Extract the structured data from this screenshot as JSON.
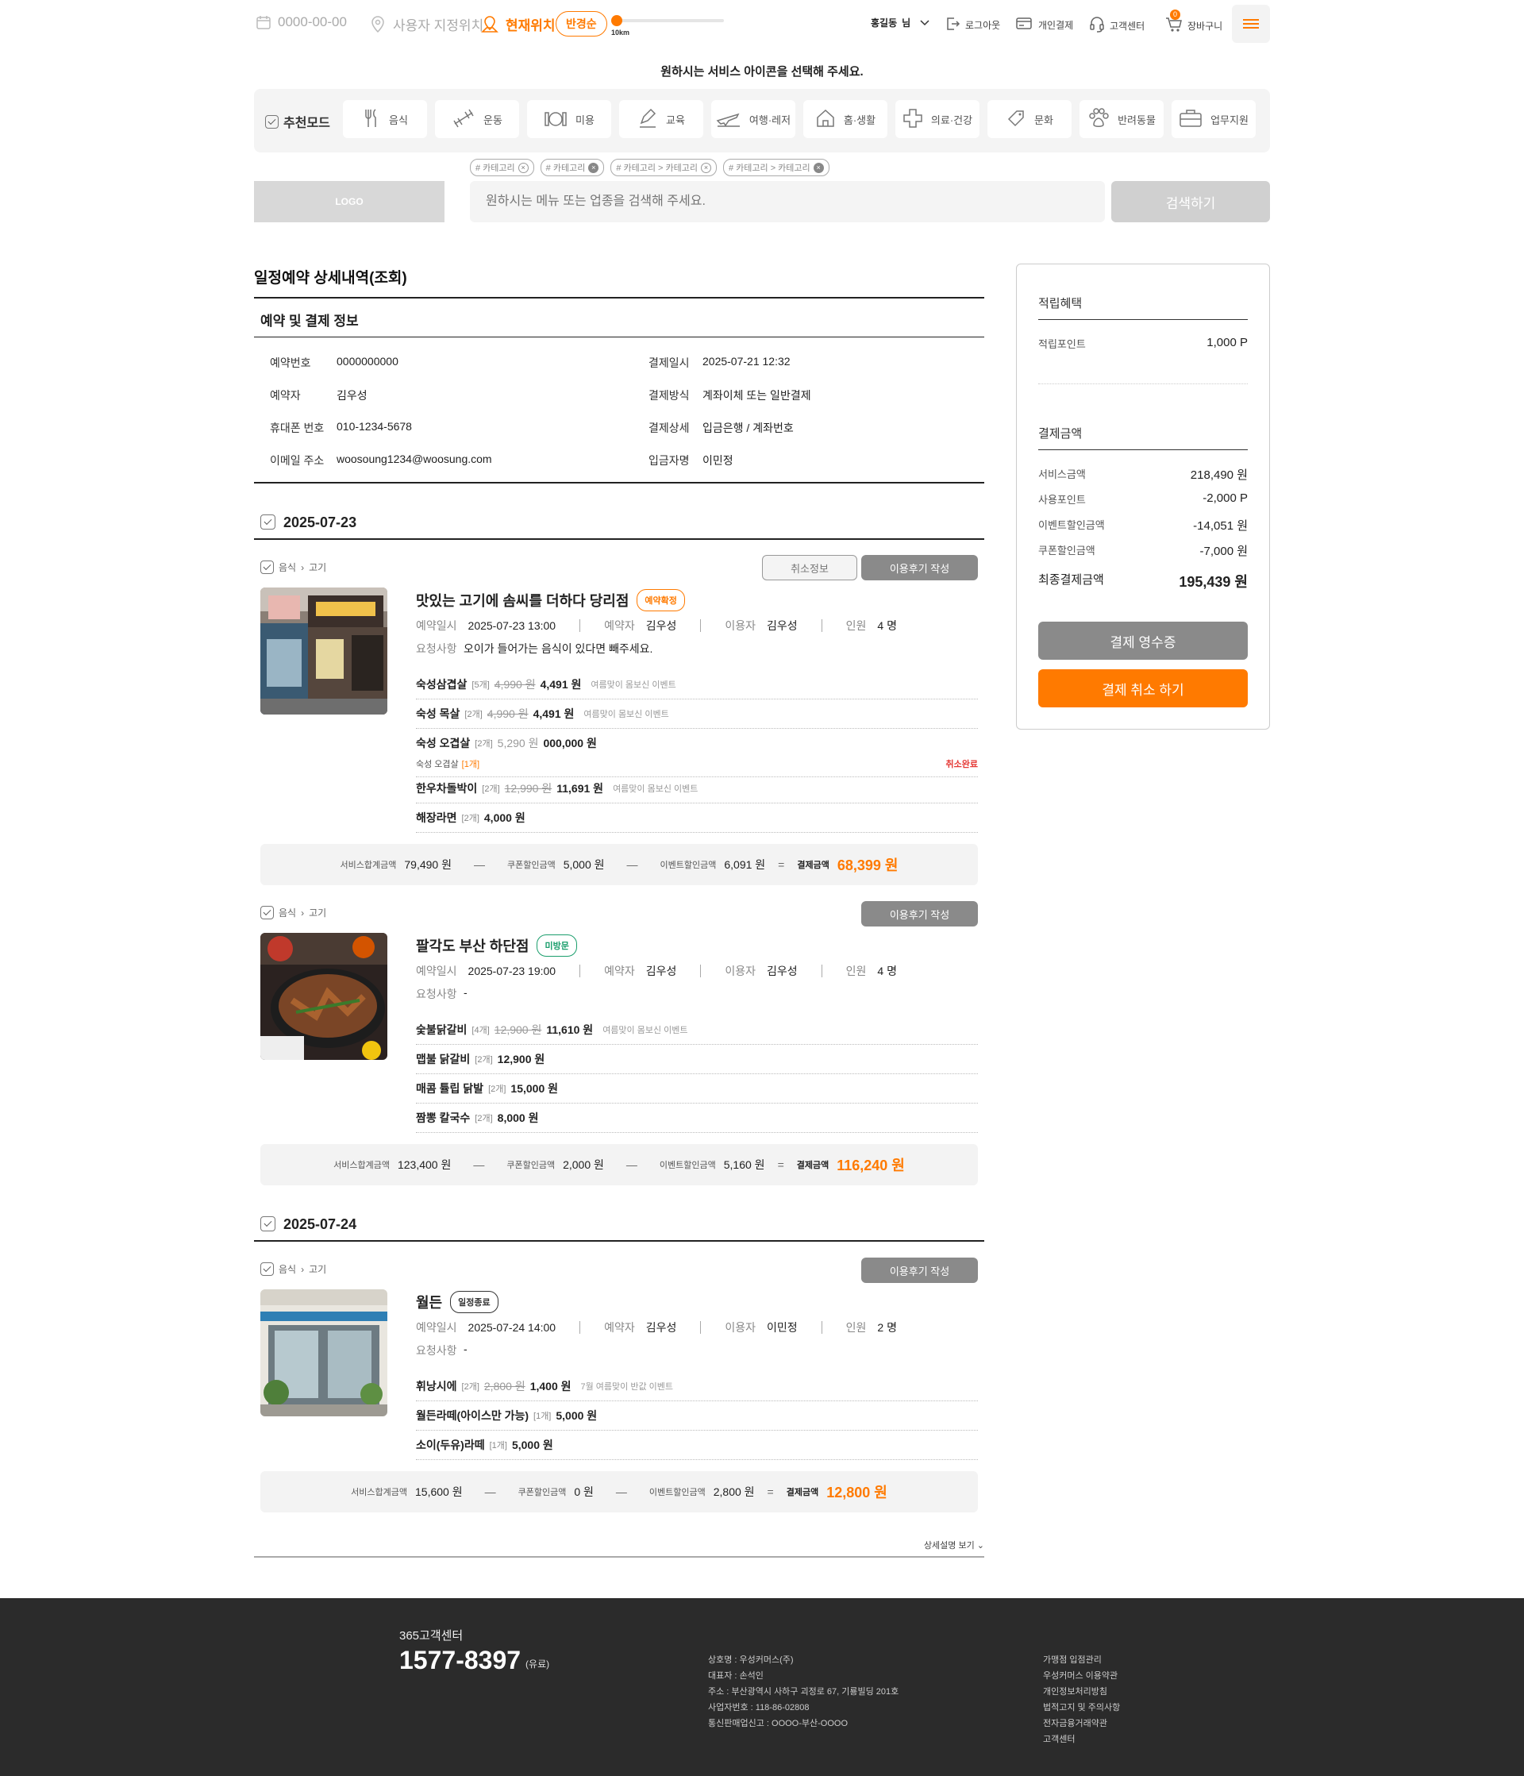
{
  "topbar": {
    "date": "0000-00-00",
    "user_location": "사용자 지정위치",
    "current_location": "현재위치",
    "radius_sort": "반경순",
    "distance": "10km",
    "user_name": "홍길동",
    "user_suffix": "님",
    "logout": "로그아웃",
    "personal_pay": "개인결제",
    "customer_center": "고객센터",
    "cart": "장바구니",
    "cart_count": "0"
  },
  "guide_text": "원하시는 서비스 아이콘을 선택해 주세요.",
  "categories": {
    "recommend": "추천모드",
    "items": [
      "음식",
      "운동",
      "미용",
      "교육",
      "여행·레저",
      "홈·생활",
      "의료·건강",
      "문화",
      "반려동물",
      "업무지원"
    ]
  },
  "tags": [
    "# 카테고리",
    "# 카테고리",
    "# 카테고리 > 카테고리",
    "# 카테고리 > 카테고리"
  ],
  "search": {
    "logo": "LOGO",
    "placeholder": "원하시는 메뉴 또는 업종을 검색해 주세요.",
    "button": "검색하기"
  },
  "page_title": "일정예약 상세내역(조회)",
  "section_title": "예약 및 결제 정보",
  "info": {
    "left": [
      {
        "k": "예약번호",
        "v": "0000000000"
      },
      {
        "k": "예약자",
        "v": "김우성"
      },
      {
        "k": "휴대폰 번호",
        "v": "010-1234-5678"
      },
      {
        "k": "이메일 주소",
        "v": "woosoung1234@woosung.com"
      }
    ],
    "right": [
      {
        "k": "결제일시",
        "v": "2025-07-21  12:32"
      },
      {
        "k": "결제방식",
        "v": "계좌이체 또는 일반결제"
      },
      {
        "k": "결제상세",
        "v": "입금은행 / 계좌번호"
      },
      {
        "k": "입금자명",
        "v": "이민정"
      }
    ]
  },
  "labels": {
    "reserve_time": "예약일시",
    "reserver": "예약자",
    "user": "이용자",
    "people": "인원",
    "request": "요청사항",
    "service_total": "서비스합계금액",
    "coupon_discount": "쿠폰할인금액",
    "event_discount": "이벤트할인금액",
    "paid": "결제금액",
    "cancel_info": "취소정보",
    "write_review": "이용후기 작성",
    "canceled": "취소완료",
    "more": "상세설명 보기"
  },
  "dates": [
    "2025-07-23",
    "2025-07-24"
  ],
  "orders": [
    {
      "crumb_a": "음식",
      "crumb_b": "고기",
      "name": "맛있는 고기에 솜씨를 더하다 당리점",
      "badge": "예약확정",
      "time": "2025-07-23  13:00",
      "reserver": "김우성",
      "user": "김우성",
      "people": "4 명",
      "request": "오이가 들어가는 음식이 있다면 빼주세요.",
      "menu": [
        {
          "name": "숙성삼겹살",
          "qty": "[5개]",
          "orig": "4,990 원",
          "price": "4,491 원",
          "event": "여름맞이 몸보신 이벤트"
        },
        {
          "name": "숙성 목살",
          "qty": "[2개]",
          "orig": "4,990 원",
          "price": "4,491 원",
          "event": "여름맞이 몸보신 이벤트"
        },
        {
          "name": "숙성 오겹살",
          "qty": "[2개]",
          "orig": "5,290 원",
          "price": "000,000 원",
          "sub": "숙성 오겹살",
          "sub_qty": "[1개]"
        },
        {
          "name": "한우차돌박이",
          "qty": "[2개]",
          "orig": "12,990 원",
          "price": "11,691 원",
          "event": "여름맞이 몸보신 이벤트"
        },
        {
          "name": "해장라면",
          "qty": "[2개]",
          "price": "4,000 원"
        }
      ],
      "sum": {
        "service": "79,490 원",
        "coupon": "5,000 원",
        "event": "6,091 원",
        "paid": "68,399 원"
      }
    },
    {
      "crumb_a": "음식",
      "crumb_b": "고기",
      "name": "팔각도 부산 하단점",
      "badge": "미방문",
      "time": "2025-07-23  19:00",
      "reserver": "김우성",
      "user": "김우성",
      "people": "4 명",
      "request": "-",
      "menu": [
        {
          "name": "숯불닭갈비",
          "qty": "[4개]",
          "orig": "12,900 원",
          "price": "11,610 원",
          "event": "여름맞이 몸보신 이벤트"
        },
        {
          "name": "맵불 닭갈비",
          "qty": "[2개]",
          "price": "12,900 원"
        },
        {
          "name": "매콤 튤립 닭발",
          "qty": "[2개]",
          "price": "15,000 원"
        },
        {
          "name": "짬뽕 칼국수",
          "qty": "[2개]",
          "price": "8,000 원"
        }
      ],
      "sum": {
        "service": "123,400 원",
        "coupon": "2,000 원",
        "event": "5,160 원",
        "paid": "116,240 원"
      }
    },
    {
      "crumb_a": "음식",
      "crumb_b": "고기",
      "name": "월든",
      "badge": "일정종료",
      "time": "2025-07-24  14:00",
      "reserver": "김우성",
      "user": "이민정",
      "people": "2 명",
      "request": "-",
      "menu": [
        {
          "name": "휘낭시에",
          "qty": "[2개]",
          "orig": "2,800 원",
          "price": "1,400 원",
          "event": "7월 여름맞이 반값 이벤트"
        },
        {
          "name": "월든라떼(아이스만 가능)",
          "qty": "[1개]",
          "price": "5,000 원"
        },
        {
          "name": "소이(두유)라떼",
          "qty": "[1개]",
          "price": "5,000 원"
        }
      ],
      "sum": {
        "service": "15,600 원",
        "coupon": "0 원",
        "event": "2,800 원",
        "paid": "12,800 원"
      }
    }
  ],
  "sidebar": {
    "point_title": "적립혜택",
    "point_label": "적립포인트",
    "point_value": "1,000 P",
    "pay_title": "결제금액",
    "rows": [
      {
        "k": "서비스금액",
        "v": "218,490 원"
      },
      {
        "k": "사용포인트",
        "v": "-2,000 P"
      },
      {
        "k": "이벤트할인금액",
        "v": "-14,051 원"
      },
      {
        "k": "쿠폰할인금액",
        "v": "-7,000 원"
      }
    ],
    "final_label": "최종결제금액",
    "final_value": "195,439 원",
    "receipt": "결제 영수증",
    "cancel": "결제 취소 하기"
  },
  "footer": {
    "cs_title": "365고객센터",
    "phone": "1577-8397",
    "paid_note": "(유료)",
    "company": [
      "상호명 : 우성커머스(주)",
      "대표자 : 손석인",
      "주소 : 부산광역시 사하구 괴정로 67, 기룡빌딩 201호",
      "사업자번호 : 118-86-02808",
      "통신판매업신고 : OOOO-부산-OOOO"
    ],
    "links": [
      "가맹점 입점관리",
      "우성커머스 이용약관",
      "개인정보처리방침",
      "법적고지 및 주의사항",
      "전자금융거래약관",
      "고객센터"
    ]
  },
  "colors": {
    "accent": "#ff7a00",
    "confirmed": "#ff7a00",
    "unvisited": "#1a9e6c",
    "ended": "#333333",
    "footer_bg": "#2b2b2b"
  }
}
